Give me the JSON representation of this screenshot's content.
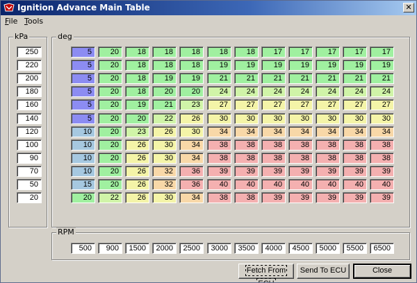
{
  "window": {
    "title": "Ignition Advance Main Table",
    "close_glyph": "✕"
  },
  "menu": [
    "File",
    "Tools"
  ],
  "kpa_label": "kPa",
  "deg_label": "deg",
  "rpm_label": "RPM",
  "kpa": [
    250,
    220,
    200,
    180,
    160,
    140,
    120,
    100,
    90,
    70,
    50,
    20
  ],
  "rpm": [
    500,
    900,
    1500,
    2000,
    2500,
    3000,
    3500,
    4000,
    4500,
    5000,
    5500,
    6500
  ],
  "table": [
    [
      5,
      20,
      18,
      18,
      18,
      18,
      18,
      17,
      17,
      17,
      17,
      17
    ],
    [
      5,
      20,
      18,
      18,
      18,
      19,
      19,
      19,
      19,
      19,
      19,
      19
    ],
    [
      5,
      20,
      18,
      19,
      19,
      21,
      21,
      21,
      21,
      21,
      21,
      21
    ],
    [
      5,
      20,
      18,
      20,
      20,
      24,
      24,
      24,
      24,
      24,
      24,
      24
    ],
    [
      5,
      20,
      19,
      21,
      23,
      27,
      27,
      27,
      27,
      27,
      27,
      27
    ],
    [
      5,
      20,
      20,
      22,
      26,
      30,
      30,
      30,
      30,
      30,
      30,
      30
    ],
    [
      10,
      20,
      23,
      26,
      30,
      34,
      34,
      34,
      34,
      34,
      34,
      34
    ],
    [
      10,
      20,
      26,
      30,
      34,
      38,
      38,
      38,
      38,
      38,
      38,
      38
    ],
    [
      10,
      20,
      26,
      30,
      34,
      38,
      38,
      38,
      38,
      38,
      38,
      38
    ],
    [
      10,
      20,
      26,
      32,
      36,
      39,
      39,
      39,
      39,
      39,
      39,
      39
    ],
    [
      15,
      20,
      26,
      32,
      36,
      40,
      40,
      40,
      40,
      40,
      40,
      40
    ],
    [
      20,
      22,
      26,
      30,
      34,
      38,
      38,
      39,
      39,
      39,
      39,
      39
    ]
  ],
  "colors": {
    "low": "#8c8cf2",
    "mid_low": "#a6c8e0",
    "green": "#a0f0a0",
    "light_green": "#d0f4a8",
    "yellow": "#f4f4a8",
    "peach": "#f8d8a8",
    "pink": "#f4b0b0"
  },
  "buttons": {
    "fetch": "Fetch From ECU",
    "send": "Send To ECU",
    "close": "Close"
  }
}
